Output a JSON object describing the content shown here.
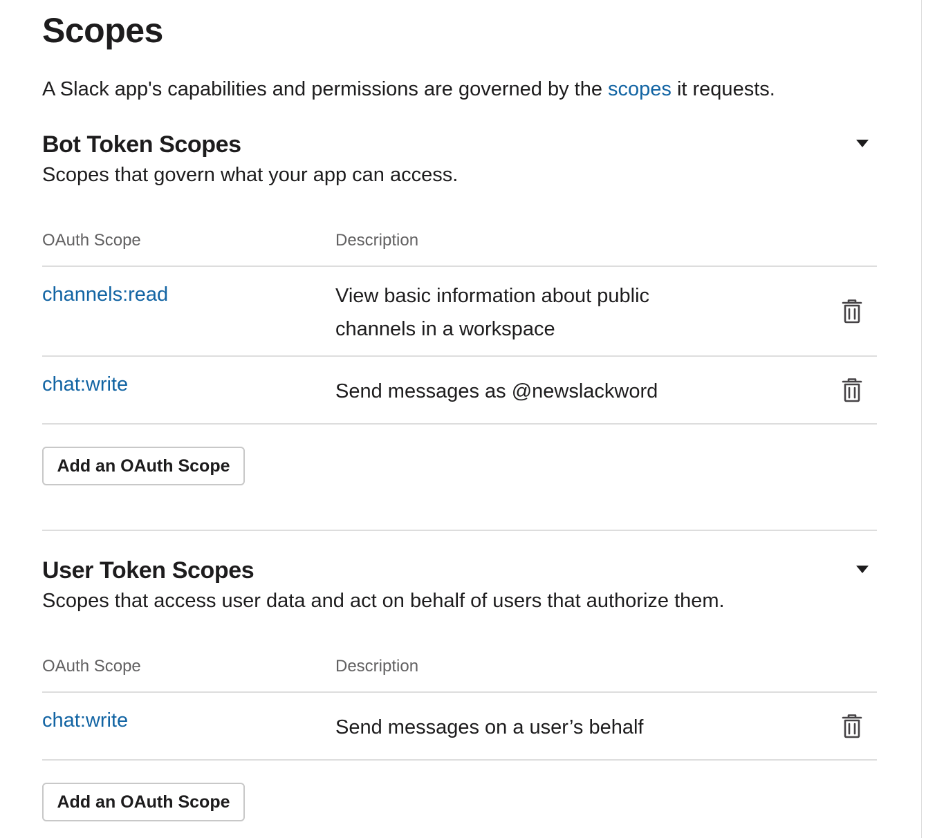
{
  "page": {
    "title": "Scopes",
    "intro_before": "A Slack app's capabilities and permissions are governed by the ",
    "intro_link": "scopes",
    "intro_after": " it requests."
  },
  "table_headers": {
    "scope": "OAuth Scope",
    "description": "Description"
  },
  "bot_section": {
    "title": "Bot Token Scopes",
    "subtitle": "Scopes that govern what your app can access.",
    "rows": [
      {
        "scope": "channels:read",
        "description": "View basic information about public channels in a workspace"
      },
      {
        "scope": "chat:write",
        "description": "Send messages as @newslackword"
      }
    ],
    "add_button": "Add an OAuth Scope"
  },
  "user_section": {
    "title": "User Token Scopes",
    "subtitle": "Scopes that access user data and act on behalf of users that authorize them.",
    "rows": [
      {
        "scope": "chat:write",
        "description": "Send messages on a user’s behalf"
      }
    ],
    "add_button": "Add an OAuth Scope"
  },
  "icons": {
    "toggle": "caret-down-icon",
    "delete": "trash-icon"
  },
  "colors": {
    "link": "#1264a3",
    "text": "#1d1c1d",
    "muted": "#616061",
    "border": "#dddddd"
  }
}
